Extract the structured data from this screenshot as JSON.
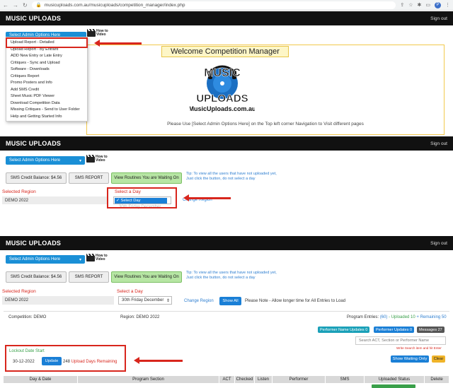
{
  "browser": {
    "url": "musicuploads.com.au/musicuploads/competition_manager/index.php",
    "avatar_letter": "P"
  },
  "brand": "MUSIC UPLOADS",
  "signout": "Sign out",
  "admin_select_label": "Select Admin Options Here",
  "howto": {
    "line1": "How to",
    "line2": "Video"
  },
  "dropdown_items": [
    "Upload Report - Detailed",
    "Upload Report - By Entrant",
    "ADD New Entry or Late Entry",
    "Critiques - Sync and Upload",
    "Software - Downloads",
    "Critiques Report",
    "Promo Posters and Info",
    "Add SMS Credit",
    "Sheet Music PDF Viewer",
    "Download Competition Data",
    "Missing Critiques - Send to User Folder",
    "Help and Getting Started Info"
  ],
  "welcome_title": "Welcome Competition Manager",
  "logo": {
    "line1": "MUSIC",
    "line2": "UPLOADS",
    "domain": "MusicUploads.com.au"
  },
  "instruction": "Please Use [Select Admin Options Here] on the Top left corner Navigation to Visit different pages",
  "sms_balance": "SMS Credit Balance: $4.56",
  "sms_report": "SMS REPORT",
  "view_routines": "View Routines You are Waiting On",
  "tip_line1": "Tip: To view all the users that have not uploaded yet,",
  "tip_line2": "Just click the button, do not select a day",
  "selected_region_label": "Selected Region",
  "region_value": "DEMO 2022",
  "select_day_label": "Select a Day",
  "select_day_value": "✓ Select Day",
  "day_option_faint": "30th Friday December",
  "change_region": "Change Region",
  "day_selected": "30th Friday December",
  "show_all": "Show All",
  "note": "Please Note - Allow longer time for All Entries to Load",
  "competition": "Competition: DEMO",
  "region_line": "Region: DEMO 2022",
  "entries": {
    "prefix": "Program Entries: ",
    "total": "(60)",
    "uploaded": " - Uploaded 10",
    "remaining": " + Remaining 50"
  },
  "chips": {
    "performer_name_updates": "Performer Name Updates 0",
    "performer_updates": "Performer Updates 0",
    "messages": "Messages 27"
  },
  "search_placeholder": "Search ACT, Section or Performer Name",
  "search_hint": "Write Search item and hit Enter",
  "lockout_label": "Lockout Date Start",
  "lockout_date": "30-12-2022",
  "update": "Update",
  "days_remaining_count": "248",
  "days_remaining_text": " Upload Days Remaining",
  "show_waiting": "Show Waiting Only",
  "clear": "Clear",
  "table_headers": [
    "Day & Date",
    "Program Section",
    "ACT",
    "Checked",
    "Listen",
    "Performer",
    "SMS",
    "Uploaded Status",
    "Delete"
  ]
}
